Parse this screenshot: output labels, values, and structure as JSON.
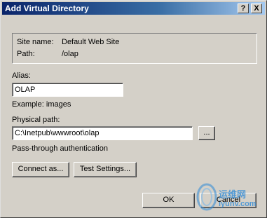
{
  "window": {
    "title": "Add Virtual Directory",
    "help_label": "?",
    "close_label": "X"
  },
  "info": {
    "site_name_label": "Site name:",
    "site_name_value": "Default Web Site",
    "path_label": "Path:",
    "path_value": "/olap"
  },
  "alias": {
    "label": "Alias:",
    "value": "OLAP",
    "example": "Example: images"
  },
  "physical_path": {
    "label": "Physical path:",
    "value": "C:\\Inetpub\\wwwroot\\olap",
    "browse_label": "..."
  },
  "auth": {
    "label": "Pass-through authentication",
    "connect_as_label": "Connect as...",
    "test_settings_label": "Test Settings..."
  },
  "footer": {
    "ok_label": "OK",
    "cancel_label": "Cancel"
  },
  "watermark": {
    "text": "运维网",
    "url": "iyunv.com"
  }
}
